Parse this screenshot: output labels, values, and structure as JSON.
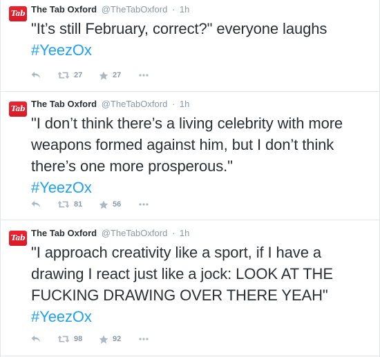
{
  "account": {
    "name": "The Tab Oxford",
    "handle": "@TheTabOxford",
    "separator": "·",
    "avatar_text": "Tab",
    "avatar_color": "#e31b23"
  },
  "hashtag_color": "#1da1f2",
  "tweets": [
    {
      "time": "1h",
      "text": "\"It’s still February, correct?\" everyone laughs",
      "hashtag": "#YeezOx",
      "retweets": "27",
      "favorites": "27"
    },
    {
      "time": "1h",
      "text": "\"I don’t think there’s a living celebrity with more weapons formed against him, but I don’t think there’s one more prosperous.\"",
      "hashtag": "#YeezOx",
      "retweets": "81",
      "favorites": "56"
    },
    {
      "time": "1h",
      "text": "\"I approach creativity like a sport, if I have a drawing I react just like a jock: LOOK AT THE FUCKING DRAWING OVER THERE YEAH\"",
      "hashtag": "#YeezOx",
      "retweets": "98",
      "favorites": "92"
    }
  ],
  "icons": {
    "reply": "reply-icon",
    "retweet": "retweet-icon",
    "favorite": "star-icon",
    "more": "more-icon"
  }
}
